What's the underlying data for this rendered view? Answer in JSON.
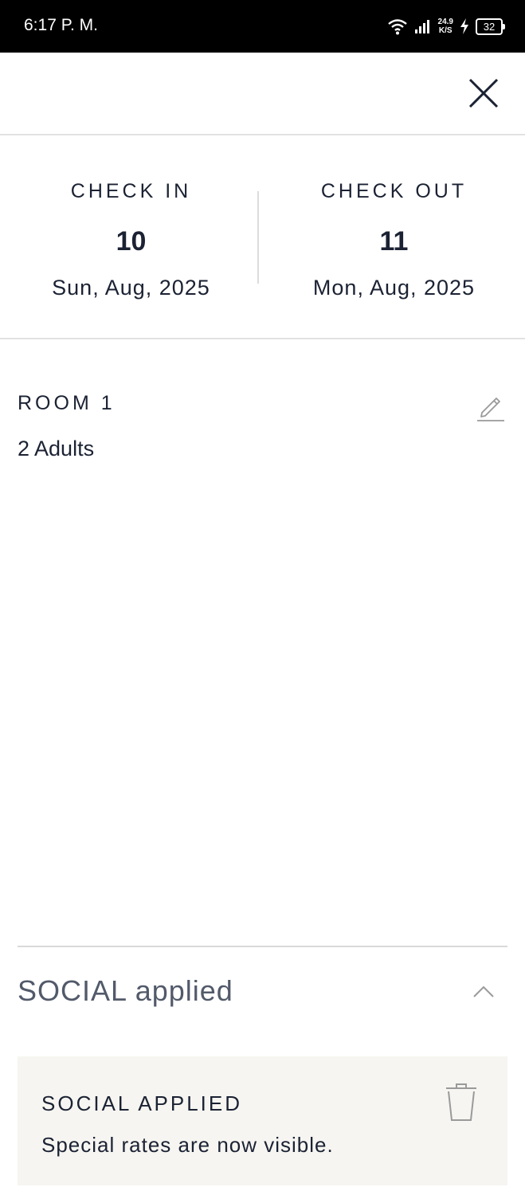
{
  "status_bar": {
    "time": "6:17 P. M.",
    "speed_value": "24.9",
    "speed_unit": "K/S",
    "battery": "32",
    "icons": [
      "wifi-icon",
      "signal-icon",
      "charging-icon",
      "battery-icon"
    ]
  },
  "header": {
    "close_icon": "close-icon"
  },
  "dates": {
    "check_in": {
      "label": "CHECK IN",
      "day": "10",
      "full": "Sun, Aug, 2025"
    },
    "check_out": {
      "label": "CHECK OUT",
      "day": "11",
      "full": "Mon, Aug, 2025"
    }
  },
  "room": {
    "title": "ROOM 1",
    "guests": "2 Adults",
    "edit_icon": "pencil-icon"
  },
  "promo": {
    "title": "SOCIAL applied",
    "chevron_icon": "chevron-up-icon",
    "card_title": "SOCIAL APPLIED",
    "card_text": "Special rates are now visible.",
    "delete_icon": "trash-icon"
  },
  "colors": {
    "text": "#1b2233",
    "muted": "#525a6a",
    "card_bg": "#f6f5f1",
    "icon_gray": "#9a9a9a"
  }
}
